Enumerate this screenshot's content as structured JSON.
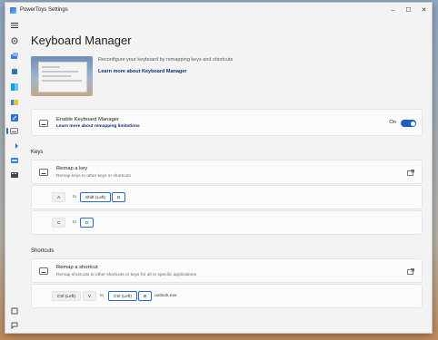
{
  "window": {
    "title": "PowerToys Settings"
  },
  "titlebar_controls": {
    "minimize": "–",
    "maximize": "☐",
    "close": "✕"
  },
  "nav": {
    "items": [
      {
        "name": "menu-icon"
      },
      {
        "name": "general-icon"
      },
      {
        "name": "always-on-top-icon"
      },
      {
        "name": "awake-icon"
      },
      {
        "name": "color-picker-icon"
      },
      {
        "name": "fancyzones-icon"
      },
      {
        "name": "file-explorer-addons-icon"
      },
      {
        "name": "keyboard-manager-icon",
        "selected": true
      },
      {
        "name": "mouse-utilities-icon"
      },
      {
        "name": "powerrename-icon"
      },
      {
        "name": "shortcut-guide-icon"
      }
    ],
    "bottom": [
      {
        "name": "welcome-icon"
      },
      {
        "name": "feedback-icon"
      }
    ]
  },
  "page": {
    "title": "Keyboard Manager",
    "description": "Reconfigure your keyboard by remapping keys and shortcuts",
    "learn_more": "Learn more about Keyboard Manager"
  },
  "enable_card": {
    "title": "Enable Keyboard Manager",
    "link": "Learn more about remapping limitations",
    "toggle_label": "On",
    "toggle_on": true
  },
  "keys_section": {
    "label": "Keys",
    "remap_title": "Remap a key",
    "remap_sub": "Remap keys to other keys or shortcuts",
    "mappings": [
      {
        "from": "A",
        "to_word": "to",
        "targets": [
          "Shift (Left)",
          "B"
        ]
      },
      {
        "from": "C",
        "to_word": "to",
        "targets": [
          "D"
        ]
      }
    ]
  },
  "shortcuts_section": {
    "label": "Shortcuts",
    "remap_title": "Remap a shortcut",
    "remap_sub": "Remap shortcuts to other shortcuts or keys for all or specific applications",
    "mappings": [
      {
        "from": [
          "Ctrl (Left)",
          "V"
        ],
        "to_word": "to",
        "targets": [
          "Ctrl (Left)",
          "B"
        ],
        "app": "outlook.exe"
      }
    ]
  },
  "colors": {
    "accent": "#1b5fbf",
    "link": "#0f2f6e"
  }
}
